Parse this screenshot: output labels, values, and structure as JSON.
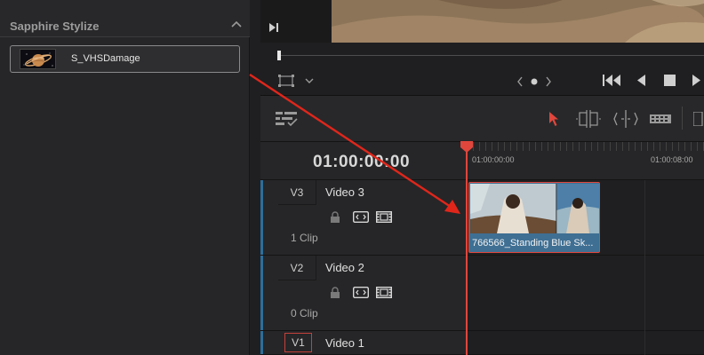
{
  "effects_panel": {
    "title": "Sapphire Stylize",
    "item_label": "S_VHSDamage"
  },
  "timeline": {
    "timecode": "01:00:00:00",
    "ruler": [
      "01:00:00:00",
      "01:00:08:00"
    ]
  },
  "tracks": [
    {
      "id": "V3",
      "name": "Video 3",
      "clips": "1 Clip"
    },
    {
      "id": "V2",
      "name": "Video 2",
      "clips": "0 Clip"
    },
    {
      "id": "V1",
      "name": "Video 1"
    }
  ],
  "clip": {
    "label": "766566_Standing Blue Sk..."
  },
  "colors": {
    "accent_red": "#e0463c",
    "clip_blue": "#3f6f93",
    "track_stripe": "#2f6d99"
  },
  "icons": [
    "chevron-up-icon",
    "next-frame-icon",
    "safe-area-icon",
    "chevron-down-icon",
    "prev-nav-icon",
    "dot-icon",
    "next-nav-icon",
    "skip-start-icon",
    "play-reverse-icon",
    "stop-icon",
    "play-icon",
    "timeline-options-icon",
    "selection-tool-icon",
    "trim-tool-icon",
    "dynamic-trim-icon",
    "blade-tool-icon",
    "lock-icon",
    "auto-select-icon",
    "film-icon",
    "playhead-icon",
    "annotation-arrow"
  ]
}
